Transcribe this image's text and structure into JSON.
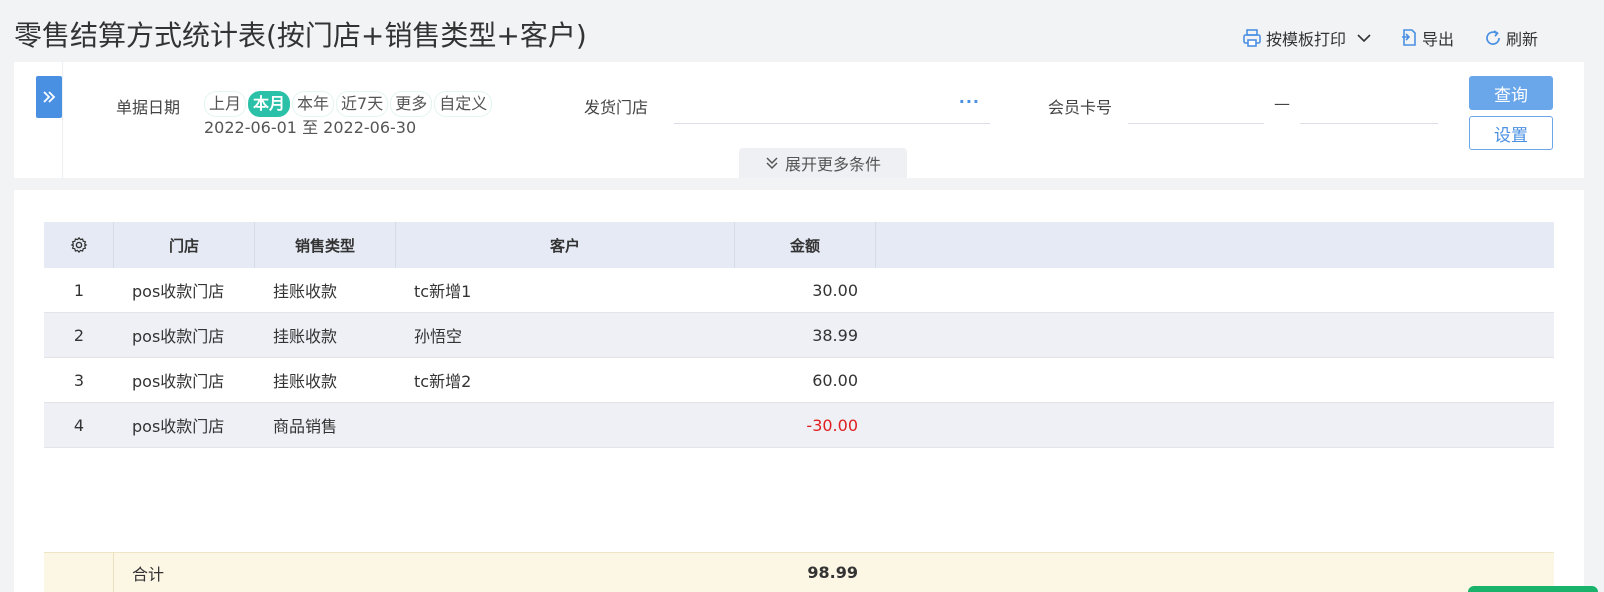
{
  "page": {
    "title": "零售结算方式统计表(按门店+销售类型+客户)"
  },
  "toolbar": {
    "print_label": "按模板打印",
    "export_label": "导出",
    "refresh_label": "刷新"
  },
  "filters": {
    "date_label": "单据日期",
    "date_options": [
      "上月",
      "本月",
      "本年",
      "近7天",
      "更多",
      "自定义"
    ],
    "date_selected": "本月",
    "date_range": "2022-06-01 至 2022-06-30",
    "store_label": "发货门店",
    "store_value": "",
    "store_more": "···",
    "card_label": "会员卡号",
    "card_from": "",
    "card_separator": "—",
    "card_to": "",
    "query_button": "查询",
    "settings_button": "设置",
    "expand_more": "展开更多条件"
  },
  "table": {
    "columns": [
      "门店",
      "销售类型",
      "客户",
      "金额"
    ],
    "rows": [
      {
        "index": "1",
        "store": "pos收款门店",
        "type": "挂账收款",
        "customer": "tc新增1",
        "amount": "30.00"
      },
      {
        "index": "2",
        "store": "pos收款门店",
        "type": "挂账收款",
        "customer": "孙悟空",
        "amount": "38.99"
      },
      {
        "index": "3",
        "store": "pos收款门店",
        "type": "挂账收款",
        "customer": "tc新增2",
        "amount": "60.00"
      },
      {
        "index": "4",
        "store": "pos收款门店",
        "type": "商品销售",
        "customer": "",
        "amount": "-30.00"
      }
    ],
    "total_label": "合计",
    "total_amount": "98.99"
  },
  "colors": {
    "accent": "#4a90e2",
    "chip_active": "#2bc0a8",
    "negative": "#e02020"
  }
}
